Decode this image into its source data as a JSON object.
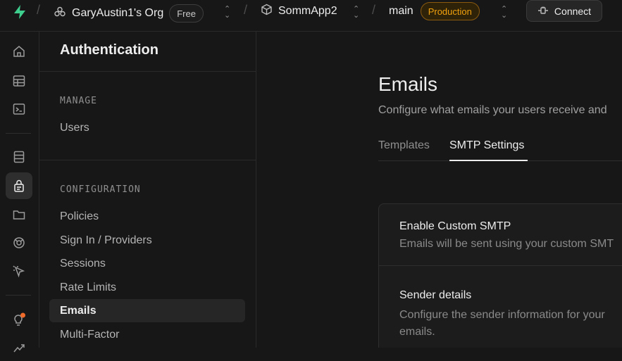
{
  "topbar": {
    "org_name": "GaryAustin1's Org",
    "org_plan": "Free",
    "project_name": "SommApp2",
    "branch_name": "main",
    "branch_env": "Production",
    "connect_label": "Connect",
    "separator": "/",
    "colors": {
      "brand": "#3ecf8e",
      "production": "#f1a10d"
    }
  },
  "rail": {
    "icons": [
      "home-icon",
      "table-editor-icon",
      "sql-editor-icon",
      "database-icon",
      "auth-icon",
      "storage-icon",
      "realtime-icon",
      "advisors-icon",
      "advisors-notification-icon",
      "reports-icon"
    ],
    "active": "auth-icon"
  },
  "menu": {
    "title": "Authentication",
    "manage_label": "MANAGE",
    "manage_items": [
      "Users"
    ],
    "config_label": "CONFIGURATION",
    "config_items": [
      "Policies",
      "Sign In / Providers",
      "Sessions",
      "Rate Limits",
      "Emails",
      "Multi-Factor"
    ],
    "active_item": "Emails"
  },
  "main": {
    "title": "Emails",
    "subtitle": "Configure what emails your users receive and",
    "tabs": [
      {
        "label": "Templates",
        "active": false
      },
      {
        "label": "SMTP Settings",
        "active": true
      }
    ],
    "card": {
      "enable_title": "Enable Custom SMTP",
      "enable_desc": "Emails will be sent using your custom SMT",
      "sender_title": "Sender details",
      "sender_desc_line1": "Configure the sender information for your",
      "sender_desc_line2": "emails."
    }
  }
}
